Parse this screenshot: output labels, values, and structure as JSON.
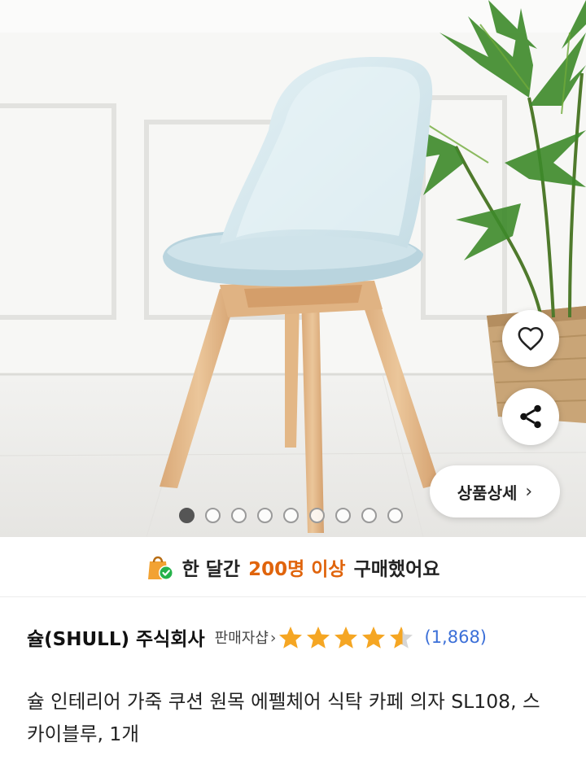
{
  "product": {
    "title": "슐 인테리어 가죽 쿠션 원목 에펠체어 식탁 카페 의자 SL108, 스카이블루, 1개"
  },
  "gallery": {
    "image_count": 9,
    "active_index": 0
  },
  "actions": {
    "wish_icon": "heart-outline-icon",
    "share_icon": "share-icon",
    "detail_label": "상품상세",
    "detail_chevron": "›"
  },
  "purchase_banner": {
    "icon": "shopping-bag-check-icon",
    "prefix": "한 달간",
    "highlight": "200명 이상",
    "suffix": "구매했어요",
    "highlight_color": "#e0640c"
  },
  "seller": {
    "name": "슐(SHULL) 주식회사",
    "link_label": "판매자샵",
    "link_arrow": "›"
  },
  "rating": {
    "stars": 4.5,
    "max": 5,
    "count_label": "(1,868)",
    "star_color": "#f5a623",
    "count_color": "#3b6fd8"
  }
}
